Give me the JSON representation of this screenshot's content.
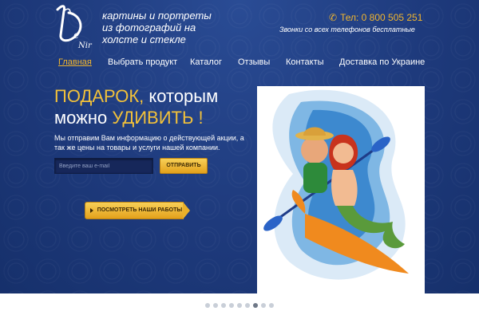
{
  "brand": {
    "logo_text": "De Nir",
    "tagline": [
      "картины и портреты",
      "из фотографий на",
      "холсте и стекле"
    ]
  },
  "contact": {
    "phone_label": "Тел: 0 800 505 251",
    "phone_icon": "phone-icon",
    "note": "Звонки со всех телефонов бесплатные"
  },
  "nav": {
    "items": [
      {
        "label": "Главная",
        "active": true
      },
      {
        "label": "Выбрать продукт",
        "active": false
      },
      {
        "label": "Каталог",
        "active": false
      },
      {
        "label": "Отзывы",
        "active": false
      },
      {
        "label": "Контакты",
        "active": false
      },
      {
        "label": "Доставка по Украине",
        "active": false
      }
    ]
  },
  "hero": {
    "headline_part1": "ПОДАРОК,",
    "headline_part2": " которым",
    "headline_part3": "можно ",
    "headline_part4": "УДИВИТЬ !",
    "intro": "Мы отправим Вам информацию о действующей акции, а так же цены на товары и услуги нашей компании.",
    "email_placeholder": "Введите ваш e-mail",
    "email_value": "",
    "submit_label": "ОТПРАВИТЬ",
    "works_label": "ПОСМОТРЕТЬ НАШИ РАБОТЫ"
  },
  "colors": {
    "background": "#1e3a7c",
    "accent": "#f2b62e",
    "button": "#eab12a"
  },
  "slider": {
    "count": 9,
    "active_index": 6
  }
}
